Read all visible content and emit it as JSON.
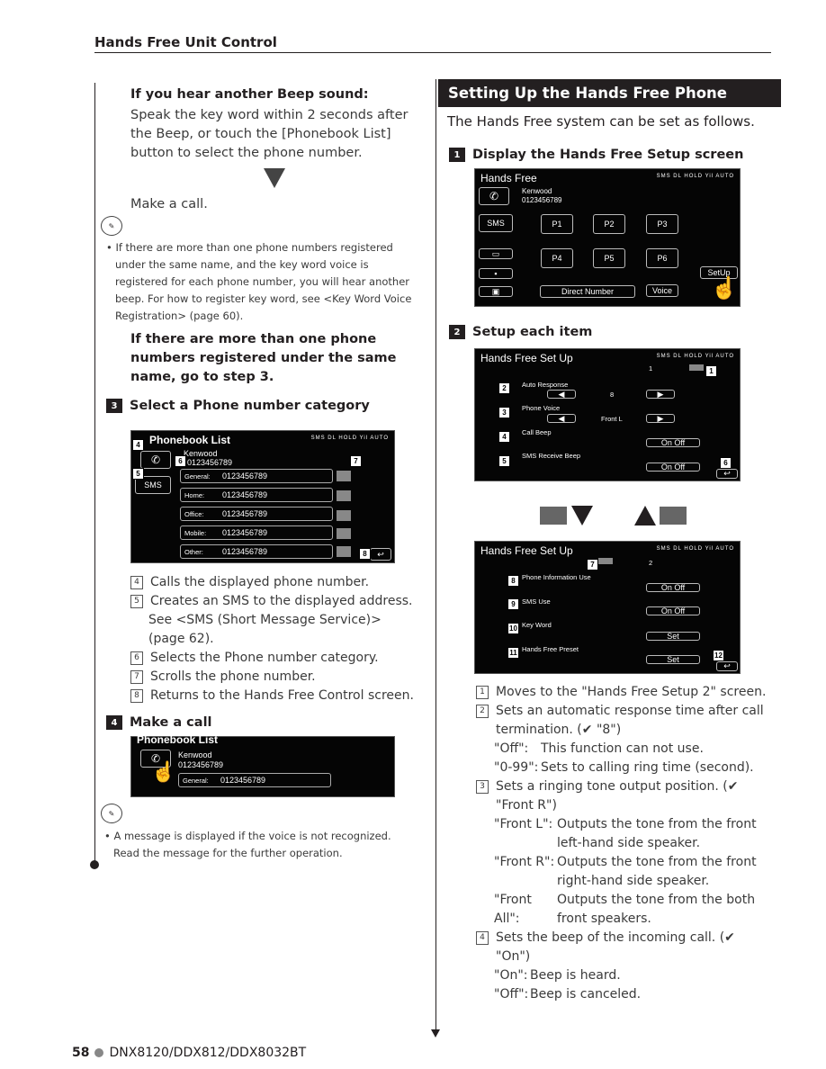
{
  "header": {
    "title": "Hands Free Unit Control"
  },
  "left": {
    "beep_heading": "If you hear another Beep sound:",
    "beep_text": "Speak the key word within 2 seconds after the Beep, or touch the [Phonebook List] button to select the phone number.",
    "make_call": "Make a call.",
    "note1": "If there are more than one phone numbers registered under the same name, and the key word voice is registered for each phone number, you will hear another beep. For how to register key word, see <Key Word Voice Registration> (page 60).",
    "multi_heading": "If there are more than one phone numbers registered under the same name, go to step 3.",
    "step3": {
      "num": "3",
      "title": "Select a Phone number category"
    },
    "phonebook": {
      "title": "Phonebook List",
      "status": "SMS DL HOLD Yil AUTO",
      "name": "Kenwood",
      "number": "0123456789",
      "sms": "SMS",
      "rows": [
        {
          "label": "General:",
          "value": "0123456789"
        },
        {
          "label": "Home:",
          "value": "0123456789"
        },
        {
          "label": "Office:",
          "value": "0123456789"
        },
        {
          "label": "Mobile:",
          "value": "0123456789"
        },
        {
          "label": "Other:",
          "value": "0123456789"
        }
      ],
      "badges": [
        "4",
        "5",
        "6",
        "7",
        "8"
      ]
    },
    "items": [
      {
        "n": "4",
        "text": "Calls the displayed phone number."
      },
      {
        "n": "5",
        "text": "Creates an SMS to the displayed address.",
        "sub": "See <SMS (Short Message Service)> (page 62)."
      },
      {
        "n": "6",
        "text": "Selects the Phone number category."
      },
      {
        "n": "7",
        "text": "Scrolls the phone number."
      },
      {
        "n": "8",
        "text": "Returns to the Hands Free Control screen."
      }
    ],
    "step4": {
      "num": "4",
      "title": "Make a call"
    },
    "call_screen": {
      "title": "Phonebook List",
      "name": "Kenwood",
      "number": "0123456789",
      "row_label": "General:",
      "row_value": "0123456789"
    },
    "note2": "A message is displayed if the voice is not recognized. Read the message for the further operation."
  },
  "right": {
    "title": "Setting Up the Hands Free Phone",
    "intro": "The Hands Free system can be set as follows.",
    "step1": {
      "num": "1",
      "title": "Display the Hands Free Setup screen"
    },
    "hf_screen": {
      "title": "Hands Free",
      "status": "SMS DL HOLD Yil AUTO",
      "name": "Kenwood",
      "number": "0123456789",
      "sms": "SMS",
      "presets": [
        "P1",
        "P2",
        "P3",
        "P4",
        "P5",
        "P6"
      ],
      "direct": "Direct Number",
      "voice": "Voice",
      "setup": "SetUp"
    },
    "step2": {
      "num": "2",
      "title": "Setup each item"
    },
    "setup1": {
      "title": "Hands Free Set Up",
      "page": "1",
      "auto_response": "Auto Response",
      "auto_value": "8",
      "phone_voice": "Phone Voice",
      "voice_value": "Front L",
      "call_beep": "Call Beep",
      "sms_beep": "SMS Receive Beep",
      "onoff": "On  Off",
      "badges": [
        "1",
        "2",
        "3",
        "4",
        "5",
        "6"
      ]
    },
    "setup2": {
      "title": "Hands Free Set Up",
      "page": "2",
      "phone_info": "Phone Information Use",
      "sms_use": "SMS Use",
      "key_word": "Key Word",
      "preset": "Hands Free Preset",
      "onoff": "On  Off",
      "set": "Set",
      "badges": [
        "7",
        "8",
        "9",
        "10",
        "11",
        "12"
      ]
    },
    "items": [
      {
        "n": "1",
        "text": "Moves to the \"Hands Free Setup 2\" screen."
      },
      {
        "n": "2",
        "text": "Sets an automatic response time after call termination. (✔ \"8\")",
        "defs": [
          {
            "k": "\"Off\":",
            "v": "This function can not use."
          },
          {
            "k": "\"0-99\":",
            "v": "Sets to calling ring time (second)."
          }
        ]
      },
      {
        "n": "3",
        "text": "Sets a ringing tone output position. (✔ \"Front R\")",
        "defs": [
          {
            "k": "\"Front L\":",
            "v": "Outputs the tone from the front left-hand side speaker."
          },
          {
            "k": "\"Front R\":",
            "v": "Outputs the tone from the front right-hand side speaker."
          },
          {
            "k": "\"Front All\":",
            "v": "Outputs the tone from the both front speakers."
          }
        ]
      },
      {
        "n": "4",
        "text": "Sets the beep of the incoming call. (✔ \"On\")",
        "defs": [
          {
            "k": "\"On\":",
            "v": "Beep is heard."
          },
          {
            "k": "\"Off\":",
            "v": "Beep is canceled."
          }
        ]
      }
    ]
  },
  "footer": {
    "page": "58",
    "models": "DNX8120/DDX812/DDX8032BT"
  }
}
